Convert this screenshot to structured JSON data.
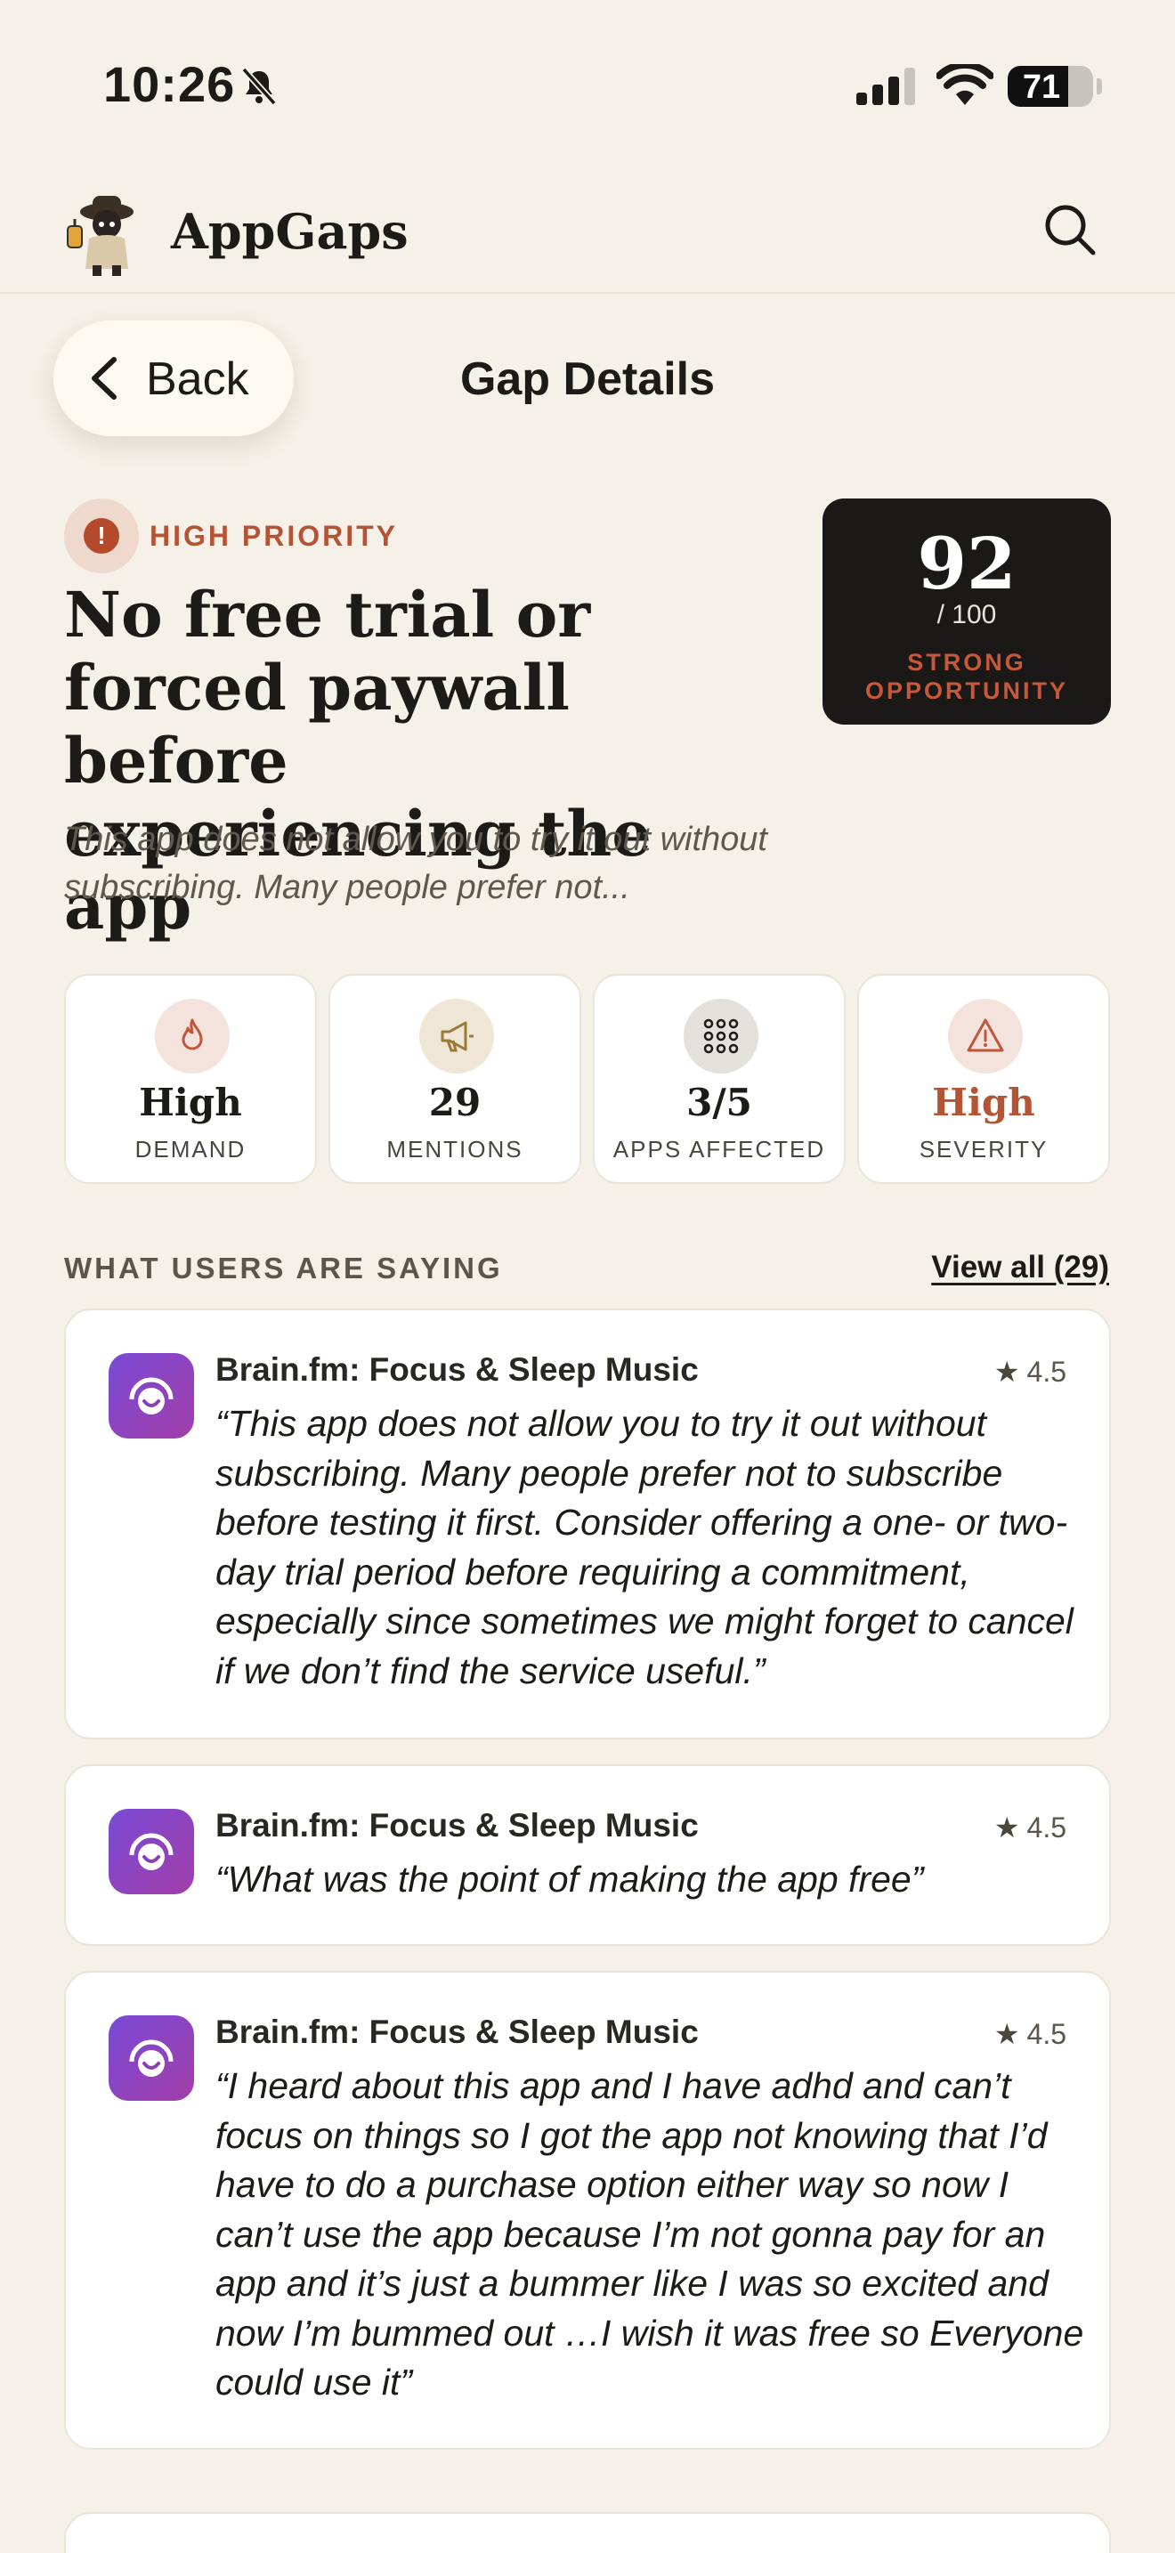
{
  "status_bar": {
    "time": "10:26",
    "battery_level": "71",
    "battery_fraction": 0.71
  },
  "header": {
    "app_name": "AppGaps"
  },
  "nav": {
    "back_label": "Back",
    "title": "Gap Details"
  },
  "gap": {
    "priority": "HIGH PRIORITY",
    "title": "No free trial or forced paywall before experiencing the app",
    "description": "This app does not allow you to try it out without subscribing. Many people prefer not...",
    "score": "92",
    "score_max": "/ 100",
    "score_label": "STRONG OPPORTUNITY"
  },
  "stats": [
    {
      "value": "High",
      "label": "DEMAND",
      "icon": "flame-icon"
    },
    {
      "value": "29",
      "label": "MENTIONS",
      "icon": "megaphone-icon"
    },
    {
      "value": "3/5",
      "label": "APPS AFFECTED",
      "icon": "apps-grid-icon"
    },
    {
      "value": "High",
      "label": "SEVERITY",
      "icon": "warning-icon"
    }
  ],
  "reviews_section": {
    "heading": "WHAT USERS ARE SAYING",
    "view_all": "View all (29)",
    "items": [
      {
        "app": "Brain.fm: Focus & Sleep Music",
        "rating": "4.5",
        "text": "“This app does not allow you to try it out without subscribing. Many people prefer not to subscribe before testing it first. Consider offering a one- or two-day trial period before requiring a commitment, especially since sometimes we might forget to cancel if we don’t find the service useful.”"
      },
      {
        "app": "Brain.fm: Focus & Sleep Music",
        "rating": "4.5",
        "text": "“What was the point of making the app free”"
      },
      {
        "app": "Brain.fm: Focus & Sleep Music",
        "rating": "4.5",
        "text": "“I heard about this app and I have adhd and can’t focus on things so I got the app not knowing that I’d have to do a purchase option either way so now I can’t use the app because I’m not gonna pay for an app and it’s just a bummer like I was so excited and now I’m bummed out …I wish it was free so Everyone could use it”"
      }
    ]
  },
  "colors": {
    "background": "#f5f1e8",
    "accent": "#b45434",
    "score_card": "#1b1917",
    "app_icon": "#7a4ad6"
  }
}
